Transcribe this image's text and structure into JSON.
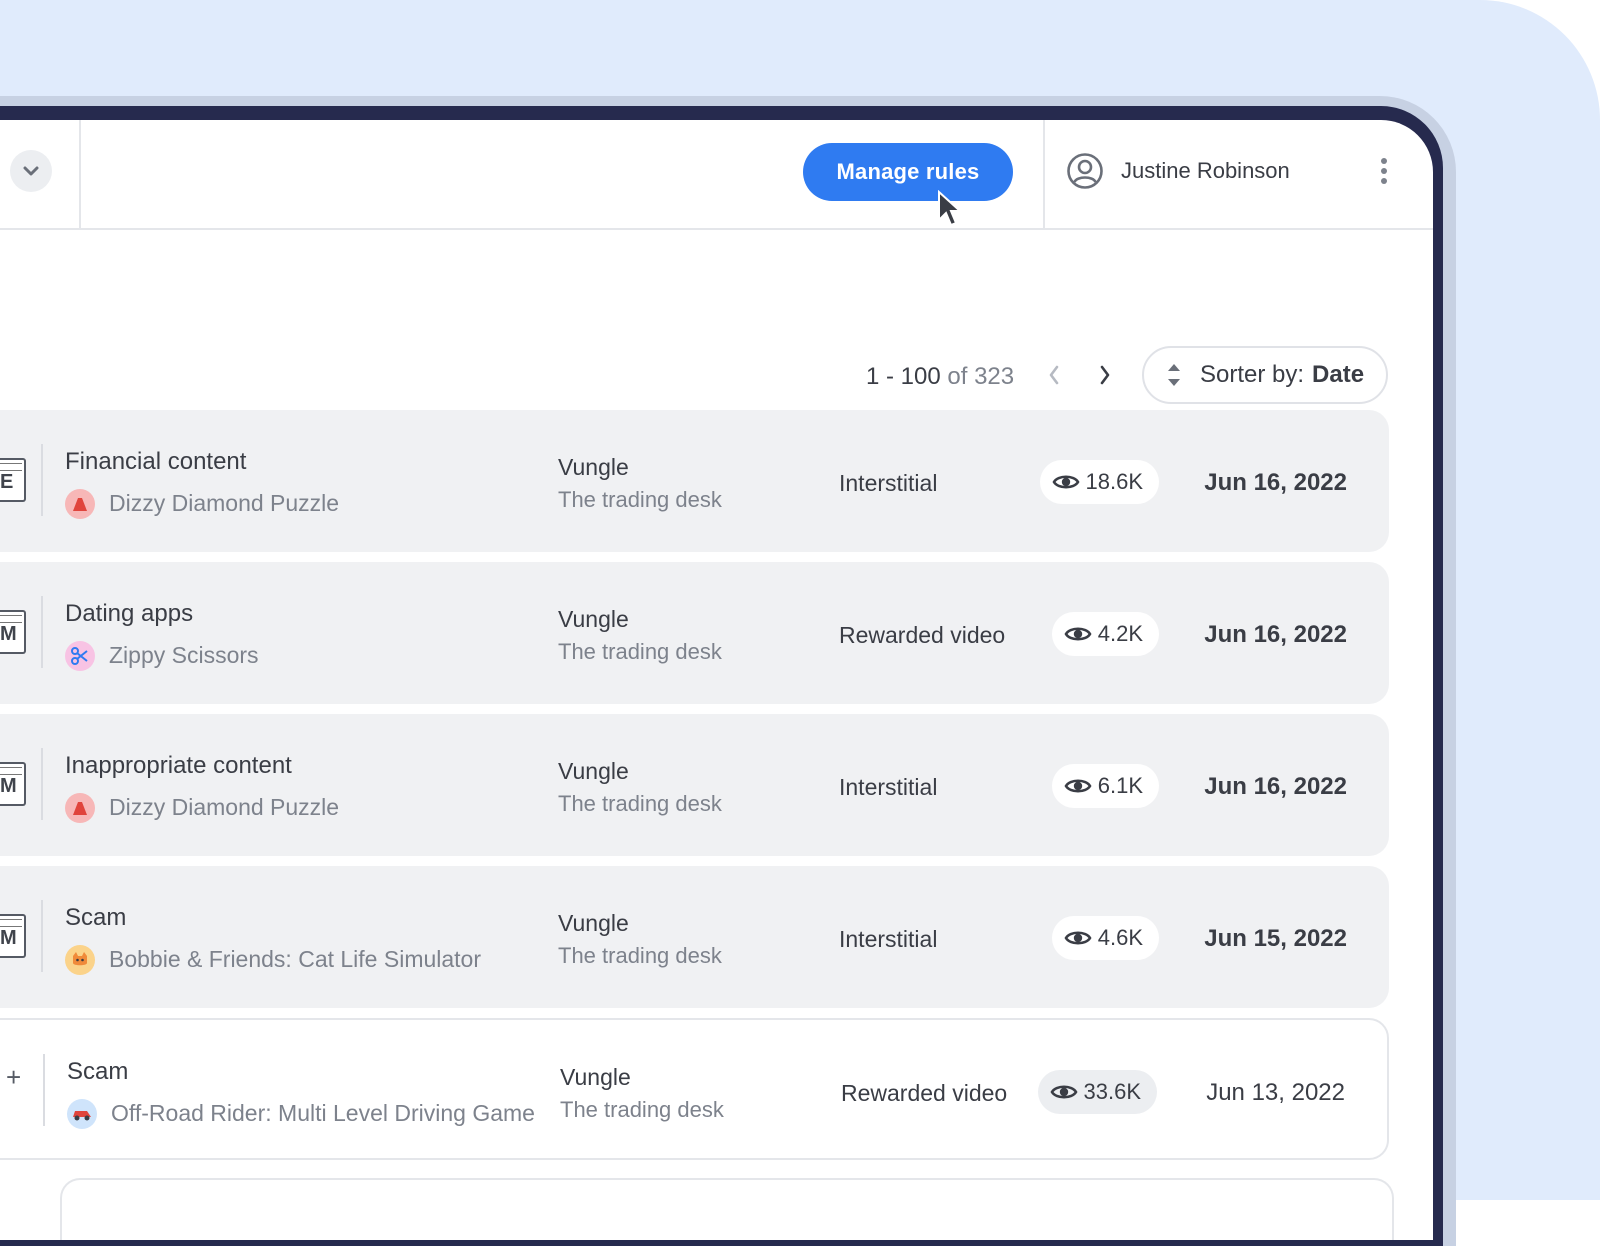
{
  "header": {
    "manage_rules_label": "Manage rules",
    "user_name": "Justine Robinson"
  },
  "pagination": {
    "range": "1 - 100",
    "of_label": "of 323"
  },
  "sorter": {
    "label": "Sorter by:",
    "value": "Date"
  },
  "rows": [
    {
      "category": "Financial content",
      "game": "Dizzy Diamond Puzzle",
      "network": "Vungle",
      "desk": "The trading desk",
      "format": "Interstitial",
      "views": "18.6K",
      "date": "Jun 16, 2022",
      "rating": "E"
    },
    {
      "category": "Dating apps",
      "game": "Zippy Scissors",
      "network": "Vungle",
      "desk": "The trading desk",
      "format": "Rewarded video",
      "views": "4.2K",
      "date": "Jun 16, 2022",
      "rating": "M"
    },
    {
      "category": "Inappropriate content",
      "game": "Dizzy Diamond Puzzle",
      "network": "Vungle",
      "desk": "The trading desk",
      "format": "Interstitial",
      "views": "6.1K",
      "date": "Jun 16, 2022",
      "rating": "M"
    },
    {
      "category": "Scam",
      "game": "Bobbie & Friends: Cat Life Simulator",
      "network": "Vungle",
      "desk": "The trading desk",
      "format": "Interstitial",
      "views": "4.6K",
      "date": "Jun 15, 2022",
      "rating": "M"
    },
    {
      "category": "Scam",
      "game": "Off-Road Rider: Multi Level Driving Game",
      "network": "Vungle",
      "desk": "The trading desk",
      "format": "Rewarded video",
      "views": "33.6K",
      "date": "Jun 13, 2022",
      "rating": "+"
    }
  ],
  "colors": {
    "accent": "#2f7bf1",
    "background": "#e0ebfc",
    "device_frame": "#262a4e",
    "row_bg": "#f0f1f3"
  }
}
